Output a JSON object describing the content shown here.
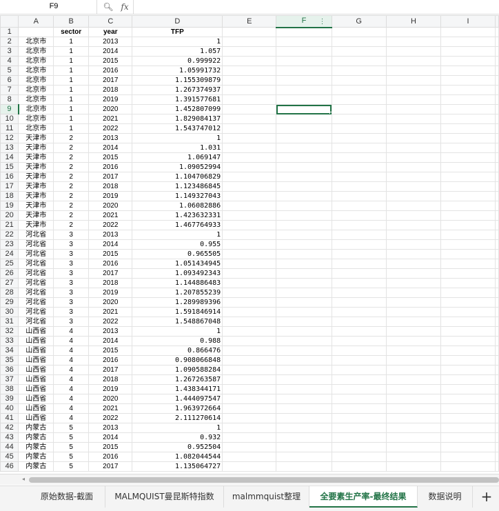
{
  "formula_bar": {
    "cell_ref": "F9",
    "zoom_icon": "zoom-icon",
    "fx_label": "fx",
    "value": ""
  },
  "columns": [
    "A",
    "B",
    "C",
    "D",
    "E",
    "F",
    "G",
    "H",
    "I"
  ],
  "selected_column": "F",
  "selected_row": 9,
  "header": {
    "A": "",
    "B": "sector",
    "C": "year",
    "D": "TFP"
  },
  "rows": [
    [
      "北京市",
      "1",
      "2013",
      "1"
    ],
    [
      "北京市",
      "1",
      "2014",
      "1.057"
    ],
    [
      "北京市",
      "1",
      "2015",
      "0.999922"
    ],
    [
      "北京市",
      "1",
      "2016",
      "1.05991732"
    ],
    [
      "北京市",
      "1",
      "2017",
      "1.155309879"
    ],
    [
      "北京市",
      "1",
      "2018",
      "1.267374937"
    ],
    [
      "北京市",
      "1",
      "2019",
      "1.391577681"
    ],
    [
      "北京市",
      "1",
      "2020",
      "1.452807099"
    ],
    [
      "北京市",
      "1",
      "2021",
      "1.829084137"
    ],
    [
      "北京市",
      "1",
      "2022",
      "1.543747012"
    ],
    [
      "天津市",
      "2",
      "2013",
      "1"
    ],
    [
      "天津市",
      "2",
      "2014",
      "1.031"
    ],
    [
      "天津市",
      "2",
      "2015",
      "1.069147"
    ],
    [
      "天津市",
      "2",
      "2016",
      "1.09052994"
    ],
    [
      "天津市",
      "2",
      "2017",
      "1.104706829"
    ],
    [
      "天津市",
      "2",
      "2018",
      "1.123486845"
    ],
    [
      "天津市",
      "2",
      "2019",
      "1.149327043"
    ],
    [
      "天津市",
      "2",
      "2020",
      "1.06082886"
    ],
    [
      "天津市",
      "2",
      "2021",
      "1.423632331"
    ],
    [
      "天津市",
      "2",
      "2022",
      "1.467764933"
    ],
    [
      "河北省",
      "3",
      "2013",
      "1"
    ],
    [
      "河北省",
      "3",
      "2014",
      "0.955"
    ],
    [
      "河北省",
      "3",
      "2015",
      "0.965505"
    ],
    [
      "河北省",
      "3",
      "2016",
      "1.051434945"
    ],
    [
      "河北省",
      "3",
      "2017",
      "1.093492343"
    ],
    [
      "河北省",
      "3",
      "2018",
      "1.144886483"
    ],
    [
      "河北省",
      "3",
      "2019",
      "1.207855239"
    ],
    [
      "河北省",
      "3",
      "2020",
      "1.289989396"
    ],
    [
      "河北省",
      "3",
      "2021",
      "1.591846914"
    ],
    [
      "河北省",
      "3",
      "2022",
      "1.548867048"
    ],
    [
      "山西省",
      "4",
      "2013",
      "1"
    ],
    [
      "山西省",
      "4",
      "2014",
      "0.988"
    ],
    [
      "山西省",
      "4",
      "2015",
      "0.866476"
    ],
    [
      "山西省",
      "4",
      "2016",
      "0.908066848"
    ],
    [
      "山西省",
      "4",
      "2017",
      "1.090588284"
    ],
    [
      "山西省",
      "4",
      "2018",
      "1.267263587"
    ],
    [
      "山西省",
      "4",
      "2019",
      "1.438344171"
    ],
    [
      "山西省",
      "4",
      "2020",
      "1.444097547"
    ],
    [
      "山西省",
      "4",
      "2021",
      "1.963972664"
    ],
    [
      "山西省",
      "4",
      "2022",
      "2.111270614"
    ],
    [
      "内蒙古",
      "5",
      "2013",
      "1"
    ],
    [
      "内蒙古",
      "5",
      "2014",
      "0.932"
    ],
    [
      "内蒙古",
      "5",
      "2015",
      "0.952504"
    ],
    [
      "内蒙古",
      "5",
      "2016",
      "1.082044544"
    ],
    [
      "内蒙古",
      "5",
      "2017",
      "1.135064727"
    ]
  ],
  "sheet_tabs": [
    {
      "label": "原始数据-截面",
      "active": false
    },
    {
      "label": "MALMQUIST曼昆斯特指数",
      "active": false
    },
    {
      "label": "malmmquist整理",
      "active": false
    },
    {
      "label": "全要素生产率-最终结果",
      "active": true
    },
    {
      "label": "数据说明",
      "active": false
    }
  ],
  "add_sheet_label": "+",
  "colors": {
    "accent": "#217346"
  }
}
